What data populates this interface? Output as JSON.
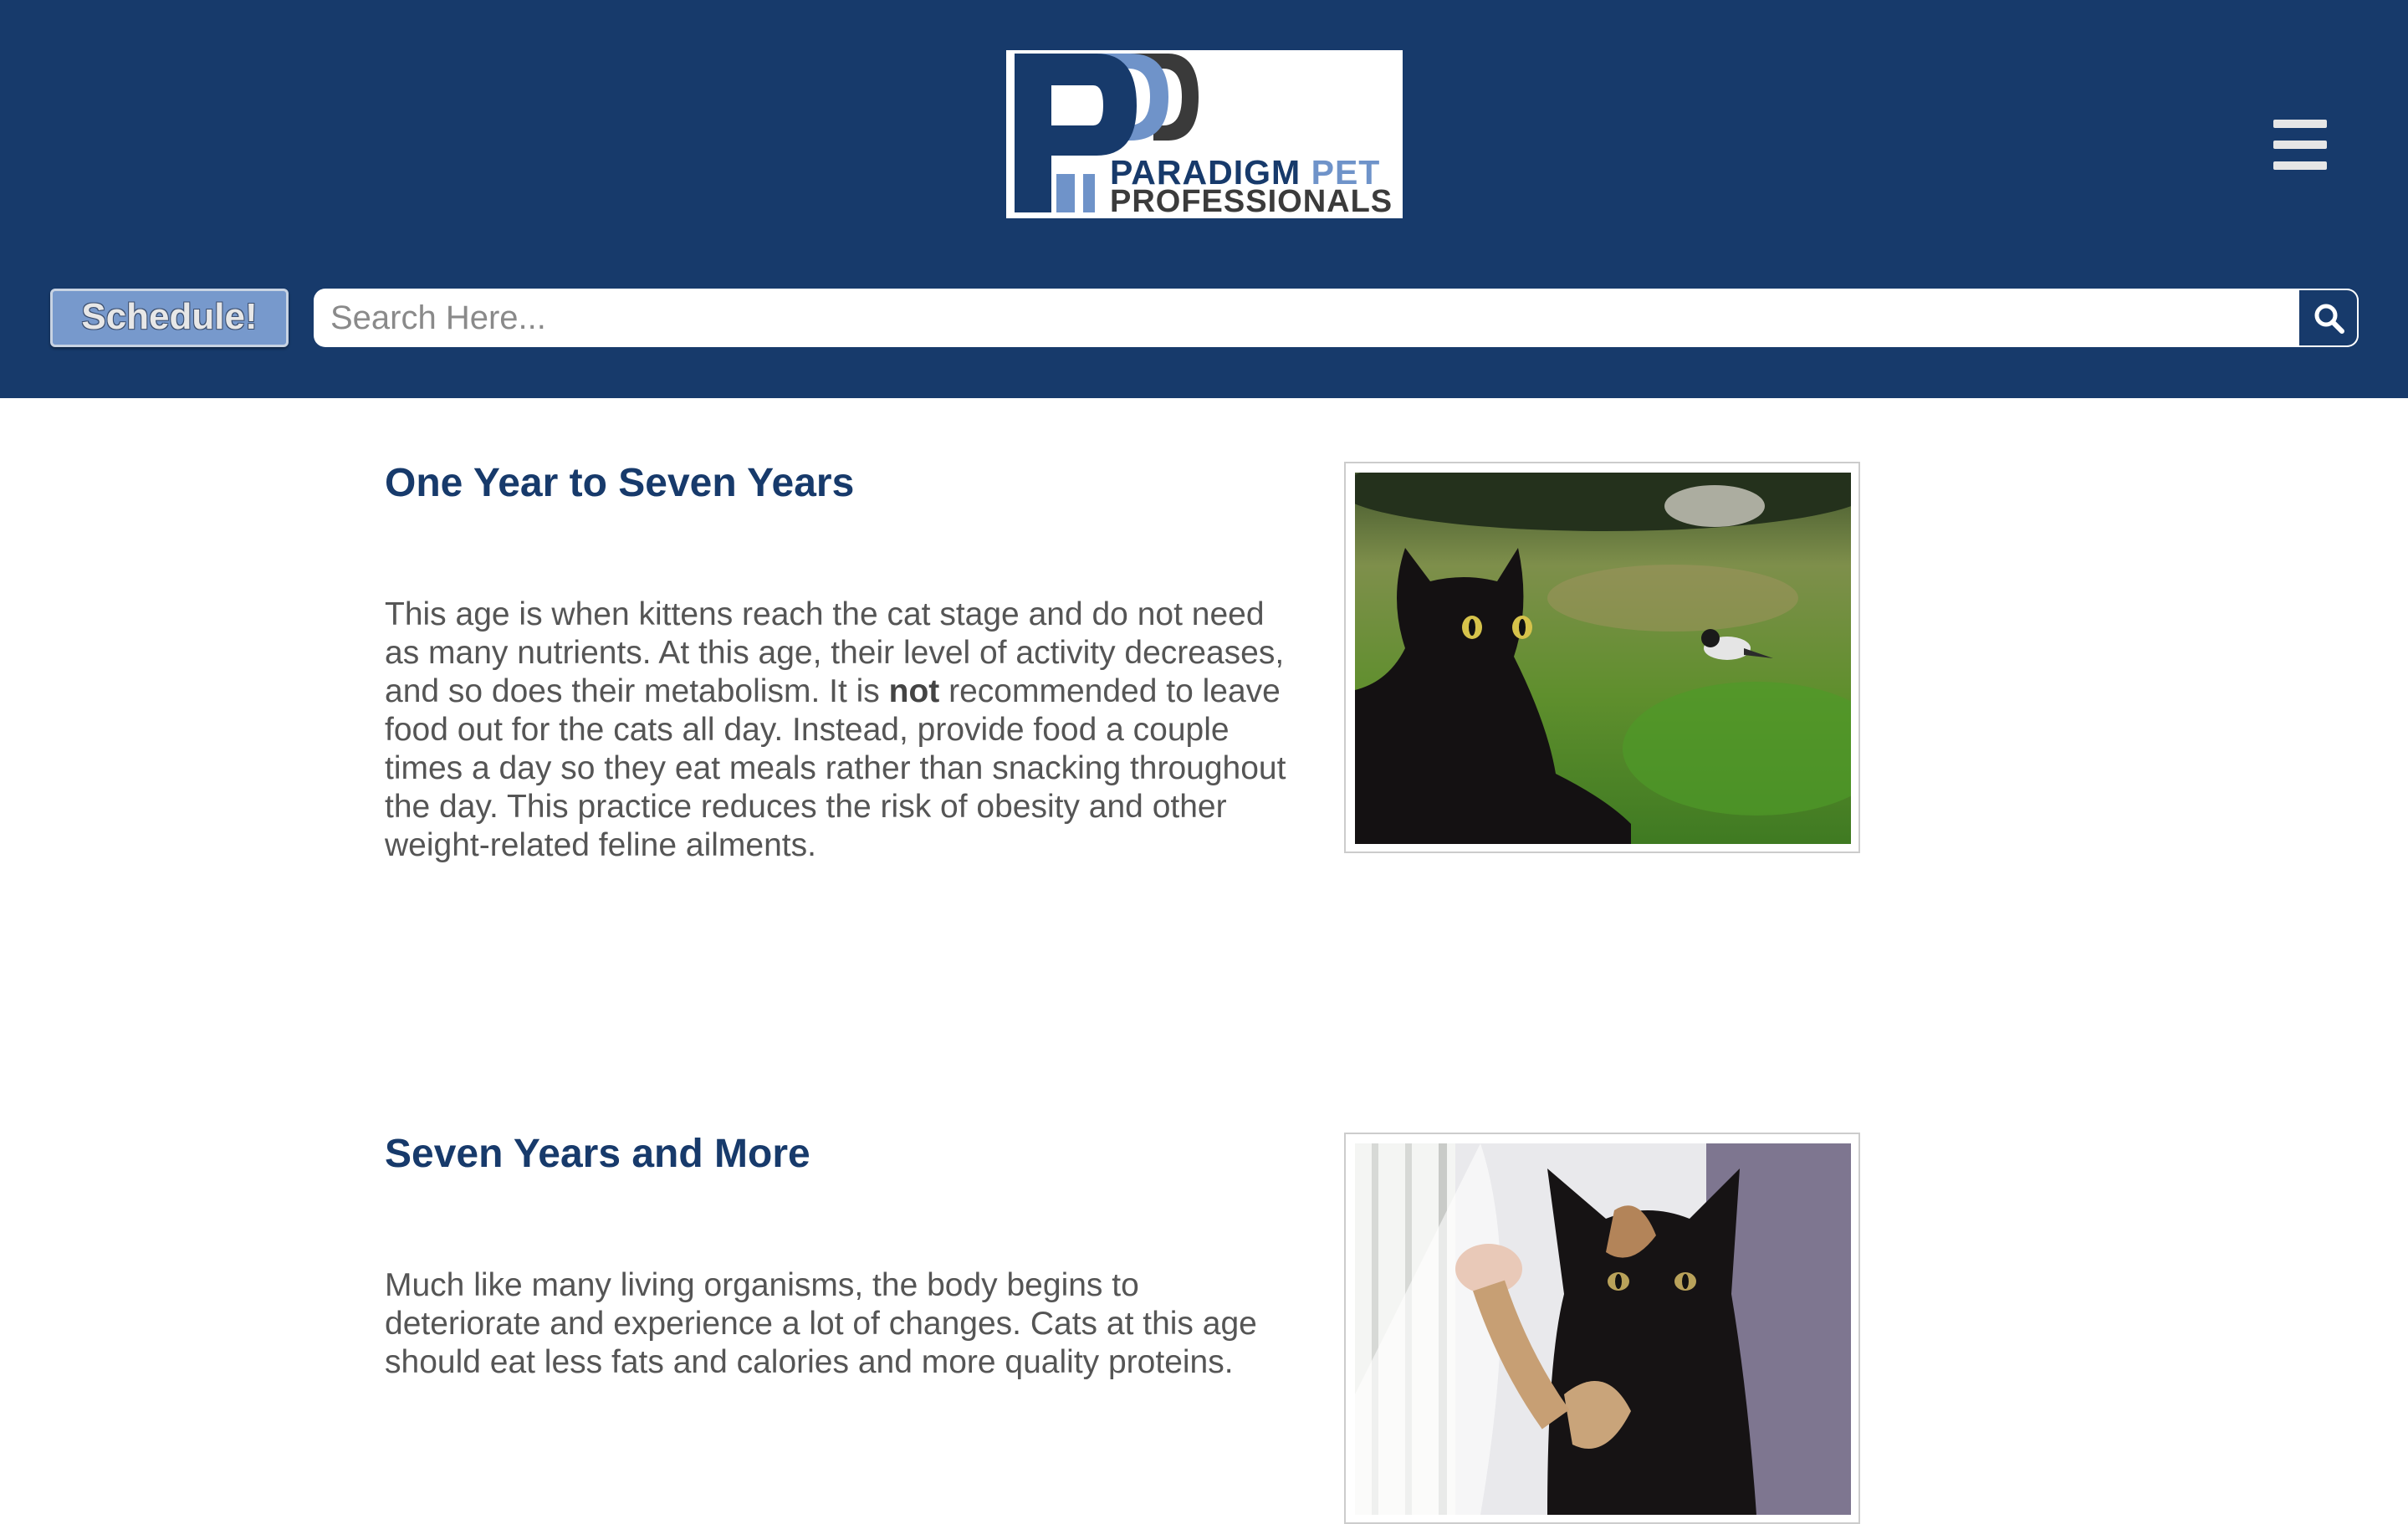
{
  "header": {
    "logo": {
      "line1_word1": "PARADIGM",
      "line1_word2": "PET",
      "line2": "PROFESSIONALS",
      "brand_dark": "#173a6b",
      "brand_light": "#6f93c9"
    },
    "menu_icon": "hamburger-menu-icon",
    "schedule_label": "Schedule!",
    "search": {
      "placeholder": "Search Here...",
      "value": "",
      "icon": "search-icon"
    },
    "background": "#173a6b"
  },
  "sections": [
    {
      "title": "One Year to Seven Years",
      "text_before_bold": "This age is when kittens reach the cat stage and do not need as many nutrients. At this age, their level of activity decreases, and so does their metabolism. It is ",
      "bold": "not",
      "text_after_bold": " recommended to leave food out for the cats all day. Instead, provide food a couple times a day so they eat meals rather than snacking throughout the day. This practice reduces the risk of obesity and other weight-related feline ailments.",
      "image": "black-cat-in-grass-with-bird"
    },
    {
      "title": "Seven Years and More",
      "text": "Much like many living organisms, the body begins to deteriorate and experience a lot of changes. Cats at this age should eat less fats and calories and more quality proteins.",
      "image": "tortoiseshell-cat-playing"
    }
  ]
}
